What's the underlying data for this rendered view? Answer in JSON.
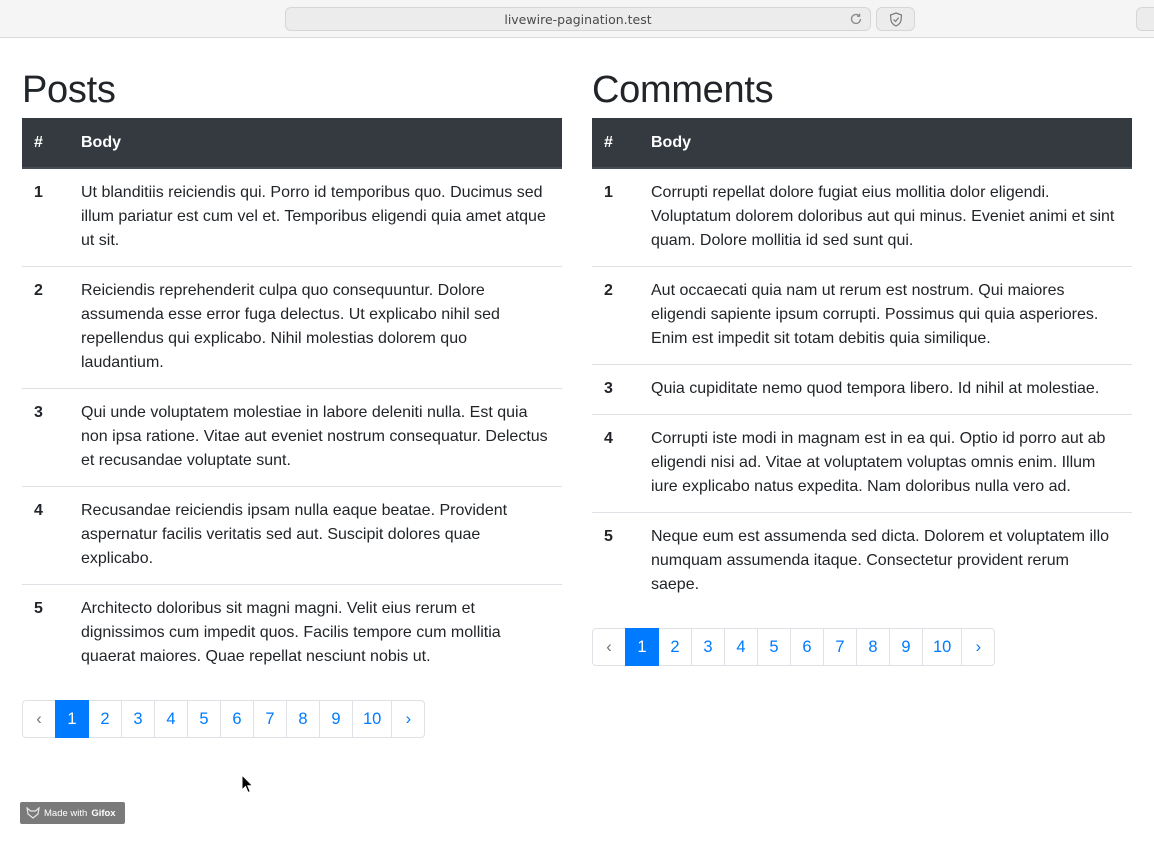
{
  "browser": {
    "url": "livewire-pagination.test"
  },
  "posts": {
    "title": "Posts",
    "headers": {
      "num": "#",
      "body": "Body"
    },
    "rows": [
      {
        "num": "1",
        "body": "Ut blanditiis reiciendis qui. Porro id temporibus quo. Ducimus sed illum pariatur est cum vel et. Temporibus eligendi quia amet atque ut sit."
      },
      {
        "num": "2",
        "body": "Reiciendis reprehenderit culpa quo consequuntur. Dolore assumenda esse error fuga delectus. Ut explicabo nihil sed repellendus qui explicabo. Nihil molestias dolorem quo laudantium."
      },
      {
        "num": "3",
        "body": "Qui unde voluptatem molestiae in labore deleniti nulla. Est quia non ipsa ratione. Vitae aut eveniet nostrum consequatur. Delectus et recusandae voluptate sunt."
      },
      {
        "num": "4",
        "body": "Recusandae reiciendis ipsam nulla eaque beatae. Provident aspernatur facilis veritatis sed aut. Suscipit dolores quae explicabo."
      },
      {
        "num": "5",
        "body": "Architecto doloribus sit magni magni. Velit eius rerum et dignissimos cum impedit quos. Facilis tempore cum mollitia quaerat maiores. Quae repellat nesciunt nobis ut."
      }
    ],
    "pagination": {
      "prev": "‹",
      "next": "›",
      "pages": [
        "1",
        "2",
        "3",
        "4",
        "5",
        "6",
        "7",
        "8",
        "9",
        "10"
      ],
      "active": "1"
    }
  },
  "comments": {
    "title": "Comments",
    "headers": {
      "num": "#",
      "body": "Body"
    },
    "rows": [
      {
        "num": "1",
        "body": "Corrupti repellat dolore fugiat eius mollitia dolor eligendi. Voluptatum dolorem doloribus aut qui minus. Eveniet animi et sint quam. Dolore mollitia id sed sunt qui."
      },
      {
        "num": "2",
        "body": "Aut occaecati quia nam ut rerum est nostrum. Qui maiores eligendi sapiente ipsum corrupti. Possimus qui quia asperiores. Enim est impedit sit totam debitis quia similique."
      },
      {
        "num": "3",
        "body": "Quia cupiditate nemo quod tempora libero. Id nihil at molestiae."
      },
      {
        "num": "4",
        "body": "Corrupti iste modi in magnam est in ea qui. Optio id porro aut ab eligendi nisi ad. Vitae at voluptatem voluptas omnis enim. Illum iure explicabo natus expedita. Nam doloribus nulla vero ad."
      },
      {
        "num": "5",
        "body": "Neque eum est assumenda sed dicta. Dolorem et voluptatem illo numquam assumenda itaque. Consectetur provident rerum saepe."
      }
    ],
    "pagination": {
      "prev": "‹",
      "next": "›",
      "pages": [
        "1",
        "2",
        "3",
        "4",
        "5",
        "6",
        "7",
        "8",
        "9",
        "10"
      ],
      "active": "1"
    }
  },
  "watermark": {
    "prefix": "Made with",
    "brand": "Gifox"
  },
  "colors": {
    "accent": "#007bff",
    "table_header": "#343a40"
  }
}
